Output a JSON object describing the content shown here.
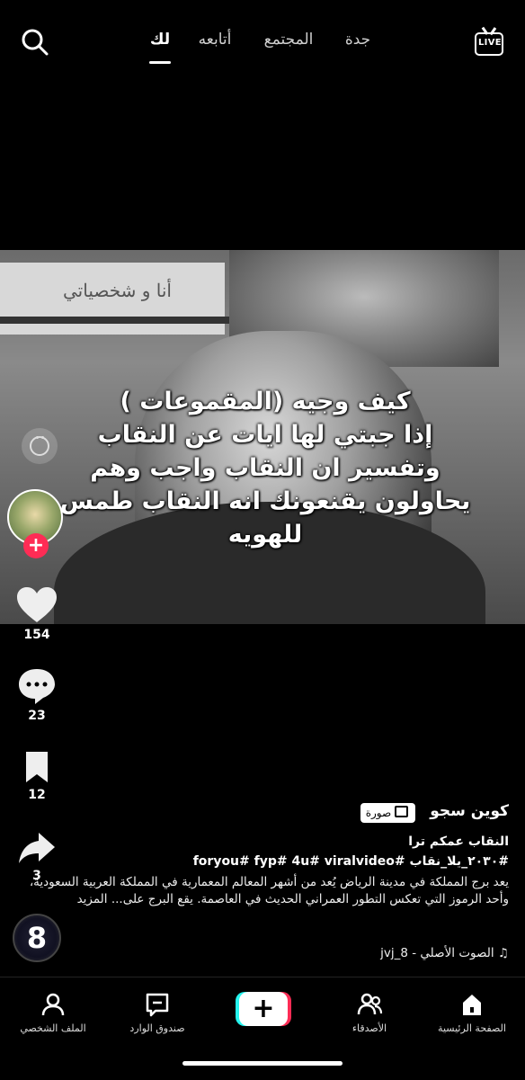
{
  "top_nav": {
    "live_label": "LIVE",
    "tabs": [
      "جدة",
      "المجتمع",
      "أتابعه",
      "لك"
    ],
    "active_tab": "لك"
  },
  "image": {
    "sign_text": "أنا و شخصياتي",
    "overlay_lines": [
      "كيف وجيه (المقموعات )",
      "إذا جبتي لها ايات عن النقاب",
      "وتفسير ان النقاب واجب وهم",
      "يحاولون يقنعونك انه النقاب طمس",
      "للهويه"
    ]
  },
  "rail": {
    "likes": "154",
    "comments": "23",
    "saves": "12",
    "shares": "3",
    "disc_label": "8"
  },
  "caption": {
    "username": "كوين سجو",
    "badge": "صورة",
    "title": "النقاب عمكم ترا",
    "hashtags": "#٢٠٣٠_يلا_نقاب #foryou# fyp# 4u# viralvideo",
    "description": "يعد برج المملكة في مدينة الرياض يُعد من أشهر المعالم المعمارية في المملكة العربية السعودية، وأحد الرموز التي تعكس التطور العمراني الحديث في العاصمة. يقع البرج على... المزيد",
    "sound": "الصوت الأصلي - jvj_8"
  },
  "bottom_nav": {
    "home": "الصفحة الرئيسية",
    "friends": "الأصدقاء",
    "inbox": "صندوق الوارد",
    "profile": "الملف الشخصي"
  },
  "colors": {
    "accent_red": "#fe2c55",
    "accent_cyan": "#25f4ee",
    "background": "#000000"
  }
}
